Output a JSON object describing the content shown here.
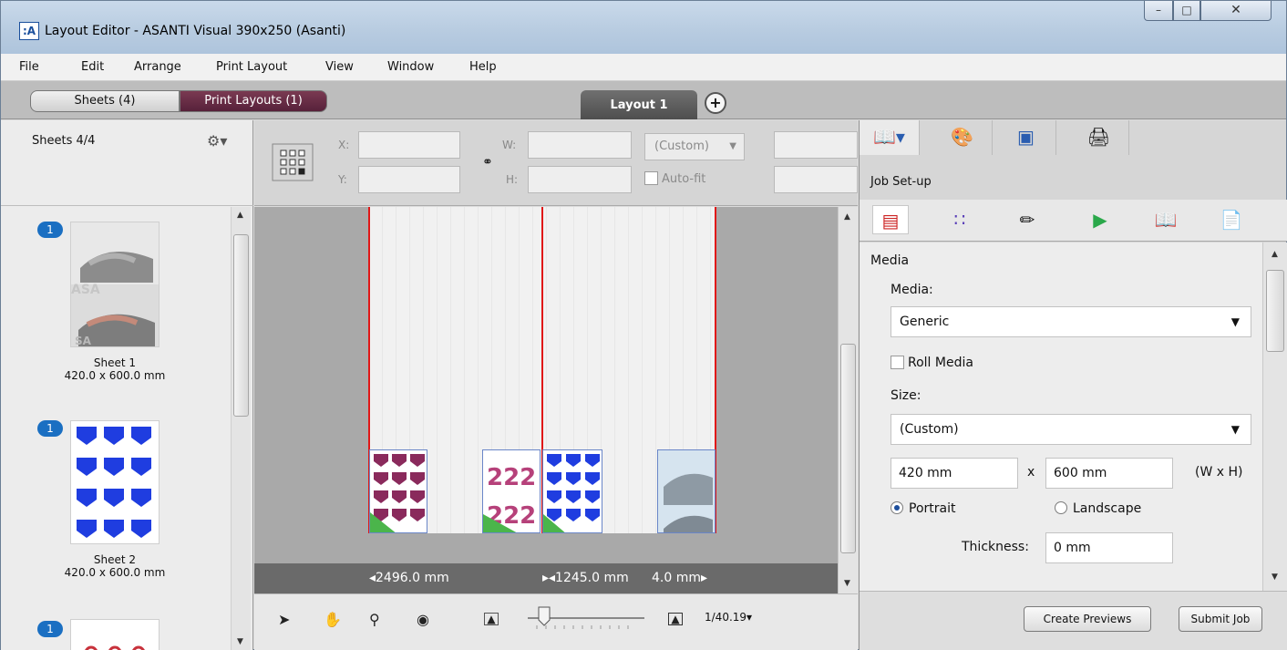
{
  "window": {
    "app_icon": ":A",
    "title": "Layout Editor - ASANTI Visual 390x250 (Asanti)",
    "controls": {
      "minimize": "–",
      "maximize": "□",
      "close": "✕"
    }
  },
  "menubar": {
    "items": [
      "File",
      "Edit",
      "Arrange",
      "Print Layout",
      "View",
      "Window",
      "Help"
    ]
  },
  "tabbar": {
    "segments": [
      "Sheets (4)",
      "Print Layouts (1)"
    ],
    "active_layout_tab": "Layout 1",
    "add_tab": "+"
  },
  "left_panel": {
    "header": "Sheets 4/4",
    "sheets": [
      {
        "badge": "1",
        "name": "Sheet 1",
        "size": "420.0 x 600.0 mm"
      },
      {
        "badge": "1",
        "name": "Sheet 2",
        "size": "420.0 x 600.0 mm"
      },
      {
        "badge": "1",
        "name": "",
        "size": ""
      }
    ]
  },
  "toolbar": {
    "x_label": "X:",
    "y_label": "Y:",
    "w_label": "W:",
    "h_label": "H:",
    "preset_value": "(Custom)",
    "autofit_label": "Auto-fit"
  },
  "canvas": {
    "ruler_left": "◂2496.0 mm",
    "ruler_mid": "▸◂1245.0 mm",
    "ruler_right": "4.0 mm▸"
  },
  "bottom_toolbar": {
    "zoom": "1/40.19▾"
  },
  "right_panel": {
    "section_title": "Job Set-up",
    "group_title": "Media",
    "media_label": "Media:",
    "media_value": "Generic",
    "roll_media_label": "Roll Media",
    "size_label": "Size:",
    "size_value": "(Custom)",
    "width_value": "420 mm",
    "height_value": "600 mm",
    "times": "x",
    "wh_hint": "(W x H)",
    "portrait_label": "Portrait",
    "landscape_label": "Landscape",
    "thickness_label": "Thickness:",
    "thickness_value": "0 mm",
    "create_previews": "Create Previews",
    "submit_job": "Submit Job"
  },
  "colors": {
    "accent_layouts": "#57213a",
    "badge": "#1a6fc2",
    "edge_red": "#e01818"
  }
}
